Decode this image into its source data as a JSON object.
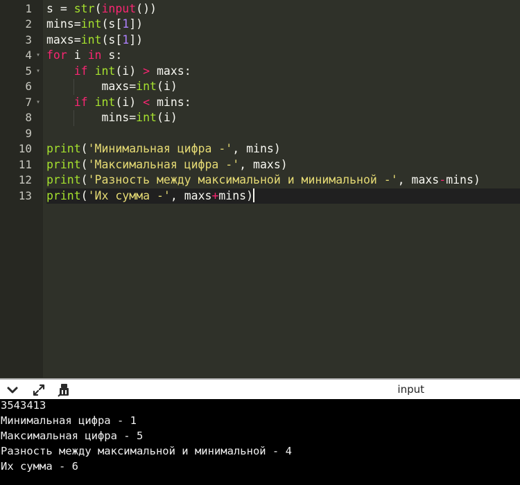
{
  "editor": {
    "theme_colors": {
      "background": "#2f3129",
      "gutter": "#272822",
      "function": "#a6e22e",
      "keyword": "#f92672",
      "number": "#ae81ff",
      "string": "#e6db74",
      "text": "#f8f8f2"
    },
    "line_numbers": [
      "1",
      "2",
      "3",
      "4",
      "5",
      "6",
      "7",
      "8",
      "9",
      "10",
      "11",
      "12",
      "13"
    ],
    "fold_markers": [
      4,
      5,
      7
    ],
    "active_line": 13,
    "lines": [
      [
        {
          "t": "s = ",
          "c": "var"
        },
        {
          "t": "str",
          "c": "fn"
        },
        {
          "t": "(",
          "c": "var"
        },
        {
          "t": "input",
          "c": "kw"
        },
        {
          "t": "())",
          "c": "var"
        }
      ],
      [
        {
          "t": "mins=",
          "c": "var"
        },
        {
          "t": "int",
          "c": "fn"
        },
        {
          "t": "(s[",
          "c": "var"
        },
        {
          "t": "1",
          "c": "num"
        },
        {
          "t": "])",
          "c": "var"
        }
      ],
      [
        {
          "t": "maxs=",
          "c": "var"
        },
        {
          "t": "int",
          "c": "fn"
        },
        {
          "t": "(s[",
          "c": "var"
        },
        {
          "t": "1",
          "c": "num"
        },
        {
          "t": "])",
          "c": "var"
        }
      ],
      [
        {
          "t": "for",
          "c": "kw"
        },
        {
          "t": " i ",
          "c": "var"
        },
        {
          "t": "in",
          "c": "kw"
        },
        {
          "t": " s:",
          "c": "var"
        }
      ],
      [
        {
          "t": "    ",
          "c": "var"
        },
        {
          "t": "if",
          "c": "kw"
        },
        {
          "t": " ",
          "c": "var"
        },
        {
          "t": "int",
          "c": "fn"
        },
        {
          "t": "(i) ",
          "c": "var"
        },
        {
          "t": ">",
          "c": "op"
        },
        {
          "t": " maxs:",
          "c": "var"
        }
      ],
      [
        {
          "t": "        maxs=",
          "c": "var"
        },
        {
          "t": "int",
          "c": "fn"
        },
        {
          "t": "(i)",
          "c": "var"
        }
      ],
      [
        {
          "t": "    ",
          "c": "var"
        },
        {
          "t": "if",
          "c": "kw"
        },
        {
          "t": " ",
          "c": "var"
        },
        {
          "t": "int",
          "c": "fn"
        },
        {
          "t": "(i) ",
          "c": "var"
        },
        {
          "t": "<",
          "c": "op"
        },
        {
          "t": " mins:",
          "c": "var"
        }
      ],
      [
        {
          "t": "        mins=",
          "c": "var"
        },
        {
          "t": "int",
          "c": "fn"
        },
        {
          "t": "(i)",
          "c": "var"
        }
      ],
      [],
      [
        {
          "t": "print",
          "c": "fn"
        },
        {
          "t": "(",
          "c": "var"
        },
        {
          "t": "'Минимальная цифра -'",
          "c": "str"
        },
        {
          "t": ", mins)",
          "c": "var"
        }
      ],
      [
        {
          "t": "print",
          "c": "fn"
        },
        {
          "t": "(",
          "c": "var"
        },
        {
          "t": "'Максимальная цифра -'",
          "c": "str"
        },
        {
          "t": ", maxs)",
          "c": "var"
        }
      ],
      [
        {
          "t": "print",
          "c": "fn"
        },
        {
          "t": "(",
          "c": "var"
        },
        {
          "t": "'Разность между максимальной и минимальной -'",
          "c": "str"
        },
        {
          "t": ", maxs",
          "c": "var"
        },
        {
          "t": "-",
          "c": "op"
        },
        {
          "t": "mins)",
          "c": "var"
        }
      ],
      [
        {
          "t": "print",
          "c": "fn"
        },
        {
          "t": "(",
          "c": "var"
        },
        {
          "t": "'Их сумма -'",
          "c": "str"
        },
        {
          "t": ", maxs",
          "c": "var"
        },
        {
          "t": "+",
          "c": "op"
        },
        {
          "t": "mins)",
          "c": "var"
        }
      ]
    ]
  },
  "toolbar": {
    "title": "input",
    "icons": [
      "chevron-down-icon",
      "expand-icon",
      "clear-console-icon"
    ]
  },
  "console": {
    "lines": [
      "3543413",
      "Минимальная цифра - 1",
      "Максимальная цифра - 5",
      "Разность между максимальной и минимальной - 4",
      "Их сумма - 6"
    ]
  }
}
